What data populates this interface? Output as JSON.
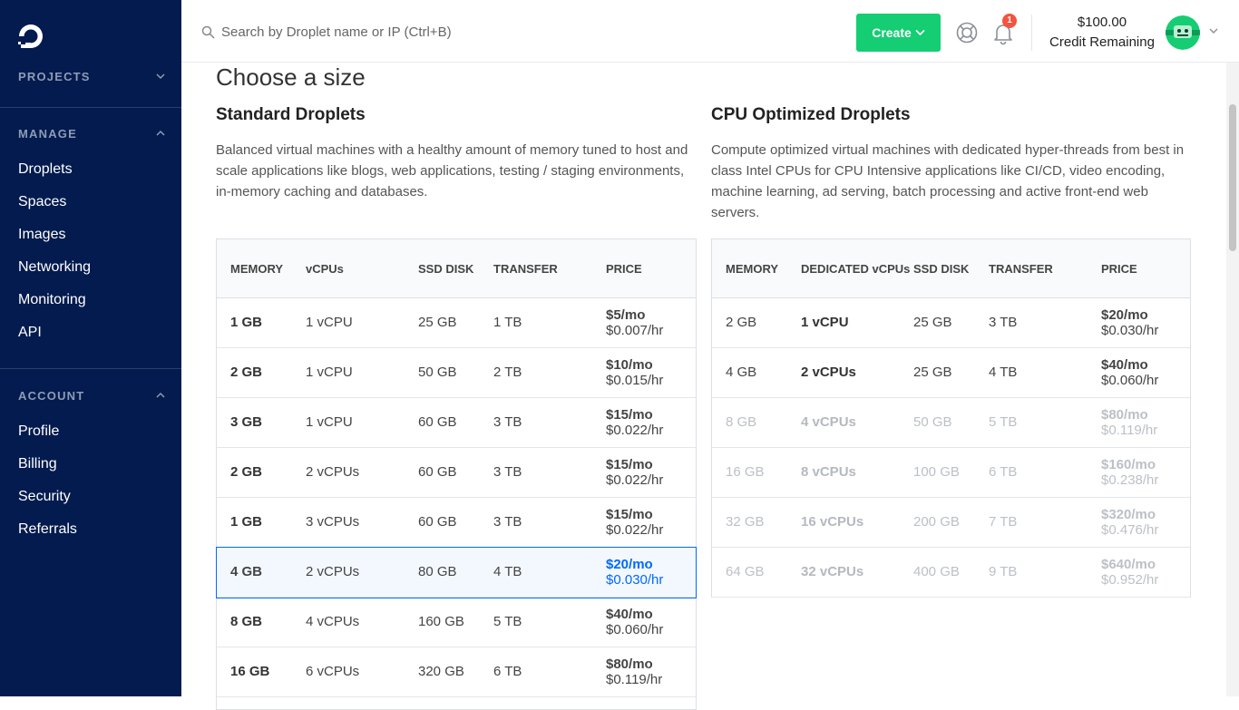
{
  "sidebar": {
    "projects": "PROJECTS",
    "manage": "MANAGE",
    "manage_items": [
      "Droplets",
      "Spaces",
      "Images",
      "Networking",
      "Monitoring",
      "API"
    ],
    "account": "ACCOUNT",
    "account_items": [
      "Profile",
      "Billing",
      "Security",
      "Referrals"
    ]
  },
  "topbar": {
    "search_placeholder": "Search by Droplet name or IP (Ctrl+B)",
    "create_label": "Create",
    "notification_count": "1",
    "credit_amount": "$100.00",
    "credit_label": "Credit Remaining"
  },
  "main": {
    "title": "Choose a size",
    "standard": {
      "title": "Standard Droplets",
      "desc": "Balanced virtual machines with a healthy amount of memory tuned to host and scale applications like blogs, web applications, testing / staging environments, in-memory caching and databases.",
      "headers": [
        "MEMORY",
        "vCPUs",
        "SSD DISK",
        "TRANSFER",
        "PRICE"
      ],
      "rows": [
        {
          "memory": "1 GB",
          "cpu": "1 vCPU",
          "disk": "25 GB",
          "transfer": "1 TB",
          "mo": "$5/mo",
          "hr": "$0.007/hr"
        },
        {
          "memory": "2 GB",
          "cpu": "1 vCPU",
          "disk": "50 GB",
          "transfer": "2 TB",
          "mo": "$10/mo",
          "hr": "$0.015/hr"
        },
        {
          "memory": "3 GB",
          "cpu": "1 vCPU",
          "disk": "60 GB",
          "transfer": "3 TB",
          "mo": "$15/mo",
          "hr": "$0.022/hr"
        },
        {
          "memory": "2 GB",
          "cpu": "2 vCPUs",
          "disk": "60 GB",
          "transfer": "3 TB",
          "mo": "$15/mo",
          "hr": "$0.022/hr"
        },
        {
          "memory": "1 GB",
          "cpu": "3 vCPUs",
          "disk": "60 GB",
          "transfer": "3 TB",
          "mo": "$15/mo",
          "hr": "$0.022/hr"
        },
        {
          "memory": "4 GB",
          "cpu": "2 vCPUs",
          "disk": "80 GB",
          "transfer": "4 TB",
          "mo": "$20/mo",
          "hr": "$0.030/hr",
          "selected": true
        },
        {
          "memory": "8 GB",
          "cpu": "4 vCPUs",
          "disk": "160 GB",
          "transfer": "5 TB",
          "mo": "$40/mo",
          "hr": "$0.060/hr"
        },
        {
          "memory": "16 GB",
          "cpu": "6 vCPUs",
          "disk": "320 GB",
          "transfer": "6 TB",
          "mo": "$80/mo",
          "hr": "$0.119/hr"
        }
      ]
    },
    "cpu": {
      "title": "CPU Optimized Droplets",
      "desc": "Compute optimized virtual machines with dedicated hyper-threads from best in class Intel CPUs for CPU Intensive applications like CI/CD, video encoding, machine learning, ad serving, batch processing and active front-end web servers.",
      "headers": [
        "MEMORY",
        "DEDICATED vCPUs",
        "SSD DISK",
        "TRANSFER",
        "PRICE"
      ],
      "rows": [
        {
          "memory": "2 GB",
          "cpu": "1 vCPU",
          "disk": "25 GB",
          "transfer": "3 TB",
          "mo": "$20/mo",
          "hr": "$0.030/hr"
        },
        {
          "memory": "4 GB",
          "cpu": "2 vCPUs",
          "disk": "25 GB",
          "transfer": "4 TB",
          "mo": "$40/mo",
          "hr": "$0.060/hr"
        },
        {
          "memory": "8 GB",
          "cpu": "4 vCPUs",
          "disk": "50 GB",
          "transfer": "5 TB",
          "mo": "$80/mo",
          "hr": "$0.119/hr",
          "disabled": true
        },
        {
          "memory": "16 GB",
          "cpu": "8 vCPUs",
          "disk": "100 GB",
          "transfer": "6 TB",
          "mo": "$160/mo",
          "hr": "$0.238/hr",
          "disabled": true
        },
        {
          "memory": "32 GB",
          "cpu": "16 vCPUs",
          "disk": "200 GB",
          "transfer": "7 TB",
          "mo": "$320/mo",
          "hr": "$0.476/hr",
          "disabled": true
        },
        {
          "memory": "64 GB",
          "cpu": "32 vCPUs",
          "disk": "400 GB",
          "transfer": "9 TB",
          "mo": "$640/mo",
          "hr": "$0.952/hr",
          "disabled": true
        }
      ]
    }
  }
}
